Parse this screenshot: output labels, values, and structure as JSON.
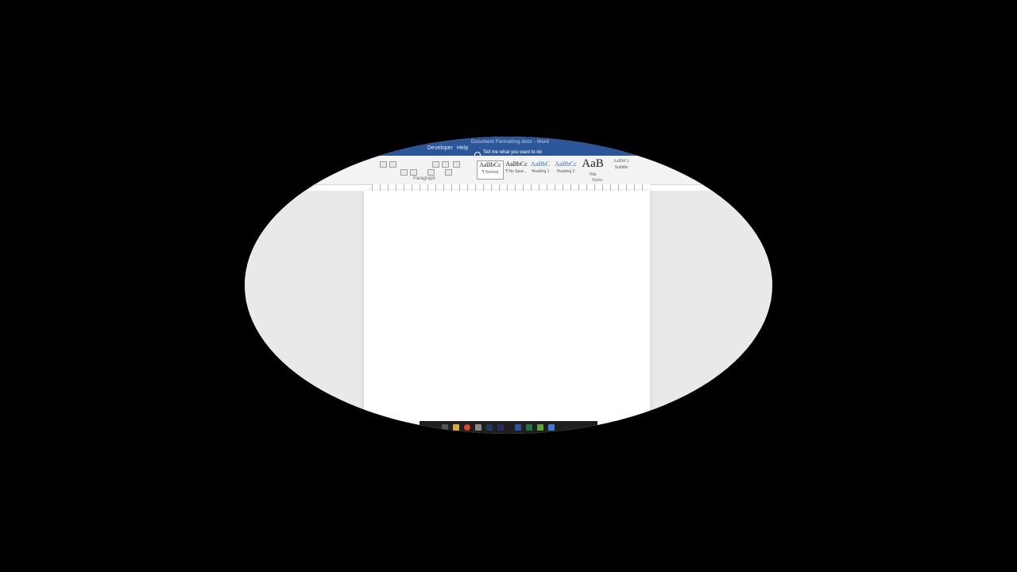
{
  "window": {
    "doc_title": "Document Formatting.docx - Word"
  },
  "ribbon": {
    "tabs": [
      "Developer",
      "Help"
    ],
    "tell_me": "Tell me what you want to do",
    "paragraph_label": "Paragraph",
    "styles_label": "Styles",
    "styles": [
      {
        "sample": "AaBbCc",
        "name": "¶ Normal"
      },
      {
        "sample": "AaBbCc",
        "name": "¶ No Spac..."
      },
      {
        "sample": "AaBbC",
        "name": "Heading 1"
      },
      {
        "sample": "AaBbCc",
        "name": "Heading 2"
      },
      {
        "sample": "AaB",
        "name": "Title"
      },
      {
        "sample": "AaBbCc",
        "name": "Subtitle"
      }
    ]
  },
  "taskbar": {
    "icons": [
      "start-icon",
      "file-explorer-icon",
      "chrome-icon",
      "photoshop-icon",
      "app-icon",
      "word-icon",
      "excel-icon"
    ]
  },
  "colors": {
    "title_bar": "#2b579a",
    "ribbon_bg": "#f3f3f3",
    "heading_blue": "#2e74b5",
    "canvas_gray": "#e9e9e9"
  }
}
